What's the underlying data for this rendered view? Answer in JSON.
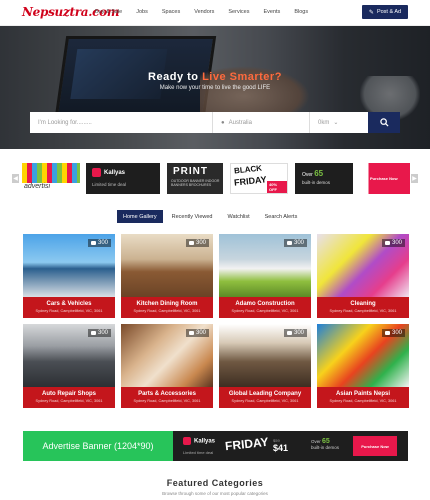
{
  "header": {
    "logo": "Nepsuztra.com",
    "nav": [
      "Buy & Sale",
      "Jobs",
      "Spaces",
      "Vendors",
      "Services",
      "Events",
      "Blogs"
    ],
    "post_ad": "Post & Ad"
  },
  "hero": {
    "title_a": "Ready to ",
    "title_b": "Live Smarter?",
    "subtitle": "Make now your time to live the good LIFE",
    "search": {
      "looking_placeholder": "I'm Looking for.........",
      "location": "Australia",
      "distance": "0km"
    }
  },
  "slider": {
    "ad1": "advertisi",
    "ad2_brand": "Kallyas",
    "ad2_sub": "Limited time deal",
    "ad3_title": "PRINT",
    "ad3_sub": "OUTDOOR BANNER INDOOR BANNERS BROCHURES",
    "ad4_a": "BLACK",
    "ad4_b": "FRIDAY",
    "ad4_c": "40% OFF",
    "ad5_a": "Over",
    "ad5_b": "65",
    "ad5_c": "built-in demos",
    "ad6": "Purchase Now"
  },
  "tabs": [
    "Home Gallery",
    "Recently Viewed",
    "Watchlist",
    "Search Alerts"
  ],
  "cards": [
    {
      "name": "Cars & Vehicles",
      "address": "Sydney Road, Campbellfield, VIC, 3061",
      "count": "300"
    },
    {
      "name": "Kitchen Dining Room",
      "address": "Sydney Road, Campbellfield, VIC, 3061",
      "count": "300"
    },
    {
      "name": "Adamo Construction",
      "address": "Sydney Road, Campbellfield, VIC, 3061",
      "count": "300"
    },
    {
      "name": "Cleaning",
      "address": "Sydney Road, Campbellfield, VIC, 3061",
      "count": "300"
    },
    {
      "name": "Auto Repair Shops",
      "address": "Sydney Road, Campbellfield, VIC, 3061",
      "count": "300"
    },
    {
      "name": "Parts & Accessories",
      "address": "Sydney Road, Campbellfield, VIC, 3061",
      "count": "300"
    },
    {
      "name": "Global Leading Company",
      "address": "Sydney Road, Campbellfield, VIC, 3061",
      "count": "300"
    },
    {
      "name": "Asian Paints Nepsi",
      "address": "Sydney Road, Campbellfield, VIC, 3061",
      "count": "300"
    }
  ],
  "bottom_banner": {
    "label": "Advertise Banner (1204*90)",
    "brand": "Kallyas",
    "brand_sub": "Limited time deal",
    "friday": "FRIDAY",
    "price_old": "$59",
    "price": "$41",
    "demos_a": "Over",
    "demos_b": "65",
    "demos_c": "built-in demos",
    "purchase": "Purchase Now"
  },
  "featured": {
    "title": "Featured Categories",
    "subtitle": "Browse through some of our most popular categories"
  },
  "colors": {
    "brand_navy": "#1a2a5e",
    "card_red": "#c4161c",
    "hero_highlight": "#ff6a3d",
    "banner_green": "#27c45a"
  }
}
